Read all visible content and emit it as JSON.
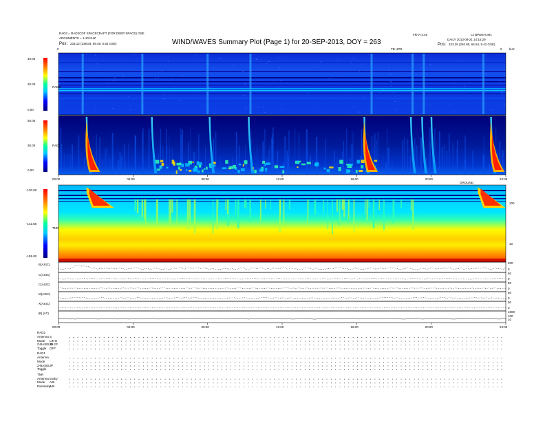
{
  "header": {
    "title": "WIND/WAVES Summary Plot (Page 1) for 20-SEP-2013, DOY = 263",
    "left_line1": "RAD2 = RAD2CDF SPACECRAFT (FOR DEEP SPACE) GSE",
    "left_line2": "ARGUMENTS = 1-10 KHZ",
    "left_pos_label": "Pos:",
    "left_pos_value": "233.12 (238.83, 59.48, 5.55 GSE)",
    "right_code": "FRTA 2.40",
    "right_id": "L2 BPDEH=M1",
    "right_line2": "DAILY 2013-09-21 14:16:29",
    "right_pos_label": "Pos:",
    "right_pos_value": "233.35 (240.85, 64.54, 8.42 GSE)",
    "top_axis_label": "TB UPR",
    "top_axis_value": "0",
    "right_top_unit": "kHz"
  },
  "panels": {
    "rad2": {
      "label": "RAD2",
      "ticks": [
        "40.00",
        "20.00",
        "0.00"
      ]
    },
    "rad1": {
      "label": "RAD1",
      "ticks": [
        "50.00",
        "30.00",
        "0.00"
      ]
    },
    "tnr": {
      "label": "TNR",
      "ticks": [
        "-130.00",
        "-142.50",
        "-155.00"
      ],
      "right_ticks": [
        "100",
        "10"
      ],
      "right_label": "GROUND"
    },
    "time_ticks": [
      "00:00",
      "04:00",
      "08:00",
      "12:00",
      "16:00",
      "20:00",
      "24:00"
    ]
  },
  "line_panels": [
    {
      "label": "B(ASIC)",
      "ticks": [
        "200",
        "0"
      ]
    },
    {
      "label": "C(ASIC)",
      "ticks": [
        "50",
        "0"
      ]
    },
    {
      "label": "C(ASIC)",
      "ticks": [
        "50",
        "0"
      ]
    },
    {
      "label": "M(ASIC)",
      "ticks": [
        "50",
        "0"
      ]
    },
    {
      "label": "X(ASIC)",
      "ticks": [
        "50",
        "0"
      ]
    },
    {
      "label": "|B| (nT)",
      "ticks": [
        "1000",
        "100",
        "10"
      ]
    }
  ],
  "status_table": {
    "groups": [
      {
        "name": "RAD2",
        "rows": [
          {
            "label": "Antenna",
            "value": "S"
          },
          {
            "label": "Mode",
            "value": "LIN E"
          },
          {
            "label": "Z-BASELIP",
            "value": "25 2P"
          },
          {
            "label": "Toggle",
            "value": "OFF"
          }
        ]
      },
      {
        "name": "RAD1",
        "rows": [
          {
            "label": "Antenna",
            "value": ""
          },
          {
            "label": "Mode",
            "value": ""
          },
          {
            "label": "Z-BASELIP",
            "value": ""
          },
          {
            "label": "Toggle",
            "value": ""
          }
        ]
      },
      {
        "name": "TNR",
        "rows": [
          {
            "label": "Antenna",
            "value": "Ex/Ey"
          },
          {
            "label": "Mode",
            "value": "A/B"
          },
          {
            "label": "Dwnsamp",
            "value": "A/B"
          }
        ]
      }
    ]
  },
  "chart_data": [
    {
      "type": "heatmap",
      "title": "RAD2",
      "ylabel": "RAD2",
      "ylim": [
        0,
        40
      ],
      "xlim": [
        "00:00",
        "24:00"
      ],
      "colormap": [
        "#000080",
        "#0000ff",
        "#00c8ff",
        "#00ffa0",
        "#ffff00",
        "#ff8000",
        "#ff0000"
      ],
      "bursts_hours": [
        1.3,
        4.5,
        8.0,
        10.3,
        16.8,
        19.0,
        19.6,
        22.8
      ]
    },
    {
      "type": "heatmap",
      "title": "RAD1",
      "ylabel": "RAD1",
      "ylim": [
        0,
        50
      ],
      "xlim": [
        "00:00",
        "24:00"
      ],
      "bursts_hours": [
        1.5,
        5.0,
        8.1,
        10.2,
        16.4,
        18.9,
        19.5,
        20.0,
        23.2
      ],
      "strong_bursts_hours": [
        1.5,
        16.4,
        23.2
      ]
    },
    {
      "type": "heatmap",
      "title": "TNR",
      "ylabel": "TNR",
      "ylim": [
        -155,
        -130
      ],
      "y2_ticks": [
        100,
        10
      ],
      "xlim": [
        "00:00",
        "24:00"
      ],
      "strong_bursts_hours": [
        1.5,
        22.5
      ]
    },
    {
      "type": "line",
      "series_count": 6,
      "xlim": [
        "00:00",
        "24:00"
      ]
    }
  ]
}
